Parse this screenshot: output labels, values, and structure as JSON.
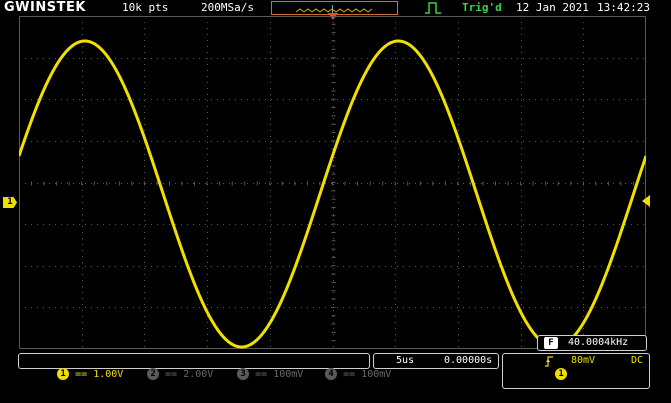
{
  "header": {
    "brand": "GWINSTEK",
    "record_length": "10k pts",
    "sample_rate": "200MSa/s",
    "trigger_status": "Trig'd",
    "date": "12 Jan 2021",
    "time": "13:42:23"
  },
  "channel_marker": "1",
  "frequency_box": {
    "icon_label": "F",
    "value": "40.0004kHz"
  },
  "channels": [
    {
      "num": "1",
      "scale": "1.00V",
      "active": true
    },
    {
      "num": "2",
      "scale": "2.00V",
      "active": false
    },
    {
      "num": "3",
      "scale": "100mV",
      "active": false
    },
    {
      "num": "4",
      "scale": "100mV",
      "active": false
    }
  ],
  "timebase": {
    "scale": "5us",
    "position": "0.00000s"
  },
  "trigger": {
    "source": "1",
    "level": "80mV",
    "coupling": "DC"
  },
  "colors": {
    "ch1": "#f0e000",
    "trig": "#33d44a",
    "grid": "#5a5a5a"
  }
}
